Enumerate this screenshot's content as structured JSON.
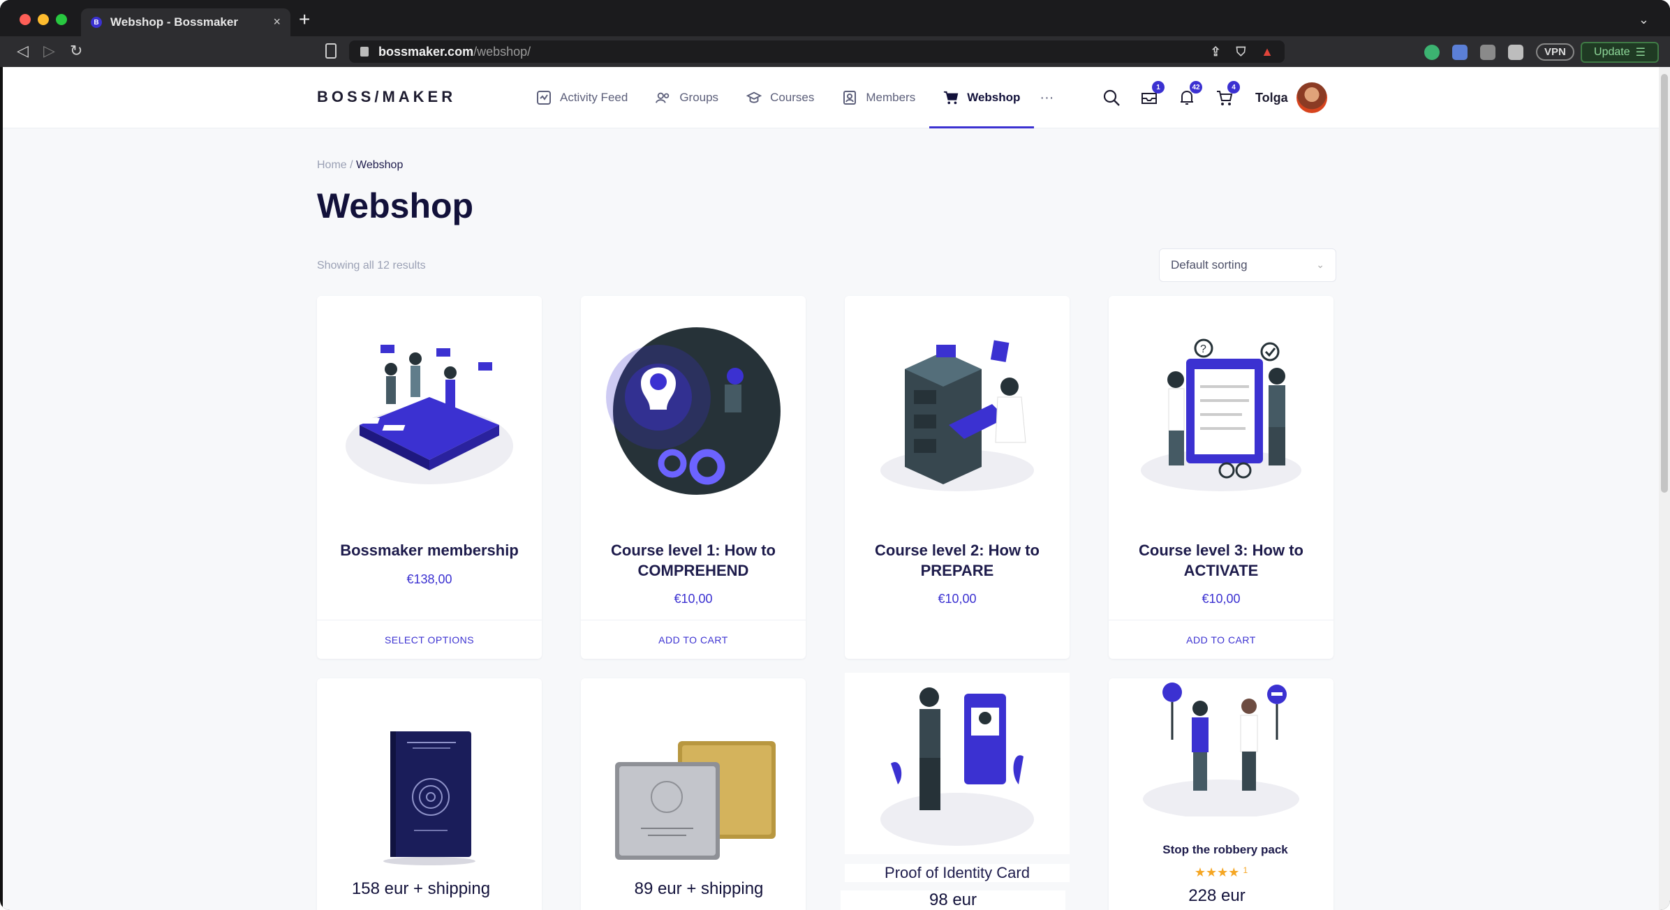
{
  "browser": {
    "tab_title": "Webshop - Bossmaker",
    "tab_favicon": "B",
    "url_host": "bossmaker.com",
    "url_path": "/webshop/",
    "vpn_label": "VPN",
    "update_label": "Update"
  },
  "header": {
    "logo": "BOSS/MAKER",
    "nav": [
      {
        "label": "Activity Feed",
        "icon": "activity-icon"
      },
      {
        "label": "Groups",
        "icon": "groups-icon"
      },
      {
        "label": "Courses",
        "icon": "courses-icon"
      },
      {
        "label": "Members",
        "icon": "members-icon"
      },
      {
        "label": "Webshop",
        "icon": "cart-icon",
        "active": true
      }
    ],
    "more": "···",
    "badges": {
      "messages": "1",
      "notifications": "42",
      "cart": "4"
    },
    "username": "Tolga"
  },
  "breadcrumb": {
    "home": "Home",
    "separator": " / ",
    "current": "Webshop"
  },
  "title": "Webshop",
  "result_count": "Showing all 12 results",
  "sort": {
    "selected": "Default sorting"
  },
  "products": [
    {
      "title": "Bossmaker membership",
      "price": "€138,00",
      "action": "SELECT OPTIONS"
    },
    {
      "title": "Course level 1: How to COMPREHEND",
      "price": "€10,00",
      "action": "ADD TO CART"
    },
    {
      "title": "Course level 2: How to PREPARE",
      "price": "€10,00",
      "action": ""
    },
    {
      "title": "Course level 3: How to ACTIVATE",
      "price": "€10,00",
      "action": "ADD TO CART"
    }
  ],
  "products_row2": [
    {
      "price": "158 eur + shipping"
    },
    {
      "price": "89 eur + shipping"
    },
    {
      "title": "Proof of Identity Card",
      "price": "98 eur"
    },
    {
      "title": "Stop the robbery pack",
      "stars": "★★★★",
      "rating_count": "1",
      "price": "228 eur"
    }
  ],
  "colors": {
    "accent": "#3b31d1",
    "dark": "#12113a",
    "star": "#f5a623"
  }
}
